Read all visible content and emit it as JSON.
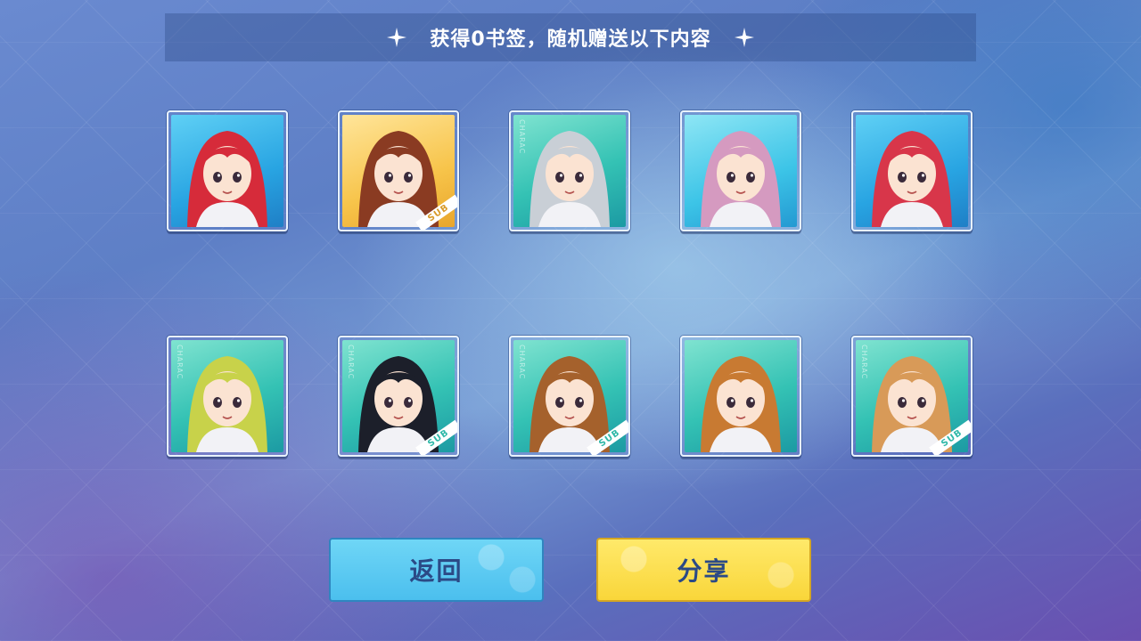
{
  "header": {
    "title": "获得0书签，随机赠送以下内容",
    "left_icon": "sparkle-icon",
    "right_icon": "sparkle-icon"
  },
  "rewards": [
    {
      "name": "red-hair-girl",
      "bg": "blue",
      "hair": "#d62b3a",
      "sub_badge": "",
      "watermark": ""
    },
    {
      "name": "brown-twintail-girl",
      "bg": "yellow",
      "hair": "#8a3b22",
      "sub_badge": "SUB",
      "watermark": ""
    },
    {
      "name": "silver-hair-woman",
      "bg": "teal",
      "hair": "#c9cfd6",
      "sub_badge": "",
      "watermark": "CHARAC"
    },
    {
      "name": "pink-hair-girl",
      "bg": "cyan",
      "hair": "#d59ac0",
      "sub_badge": "",
      "watermark": ""
    },
    {
      "name": "red-hair-schoolgirl",
      "bg": "blue",
      "hair": "#d8364a",
      "sub_badge": "",
      "watermark": ""
    },
    {
      "name": "blonde-glasses-man",
      "bg": "teal",
      "hair": "#c8d24a",
      "sub_badge": "",
      "watermark": "CHARAC"
    },
    {
      "name": "black-hair-boy",
      "bg": "teal",
      "hair": "#1c1f2a",
      "sub_badge": "SUB",
      "watermark": "CHARAC"
    },
    {
      "name": "brown-short-hair-girl",
      "bg": "teal",
      "hair": "#a5612c",
      "sub_badge": "SUB",
      "watermark": "CHARAC"
    },
    {
      "name": "orange-short-hair-girl",
      "bg": "teal",
      "hair": "#c87a32",
      "sub_badge": "",
      "watermark": ""
    },
    {
      "name": "light-brown-hair-girl",
      "bg": "teal",
      "hair": "#d89a58",
      "sub_badge": "SUB",
      "watermark": "CHARAC"
    }
  ],
  "buttons": {
    "back_label": "返回",
    "share_label": "分享"
  },
  "colors": {
    "back_button": "#4bbfee",
    "share_button": "#f9d63a",
    "button_text": "#2b4a86"
  }
}
